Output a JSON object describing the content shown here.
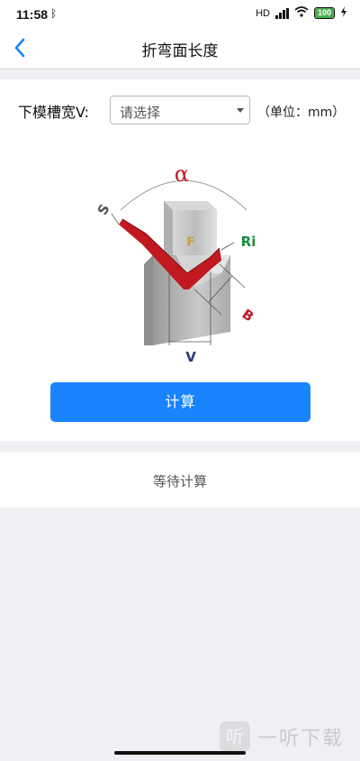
{
  "status_bar": {
    "time": "11:58",
    "bluetooth_icon": "bluetooth-icon",
    "network": "HD",
    "battery": "100"
  },
  "nav": {
    "back_icon": "chevron-left-icon",
    "title": "折弯面长度"
  },
  "form": {
    "label": "下模槽宽V:",
    "select_placeholder": "请选择",
    "unit": "（单位：mm）"
  },
  "diagram": {
    "alpha": "α",
    "s": "S",
    "f": "F",
    "ri": "Ri",
    "b": "B",
    "v": "V",
    "colors": {
      "sheet": "#c0191f",
      "ri": "#1a8a3a",
      "f": "#c8a040",
      "v": "#2a3a7a"
    }
  },
  "actions": {
    "calculate": "计算"
  },
  "result": {
    "status": "等待计算"
  },
  "watermark": {
    "logo": "听",
    "text": "一听下载"
  },
  "colors": {
    "accent": "#1a84ff",
    "background": "#efeff4"
  }
}
